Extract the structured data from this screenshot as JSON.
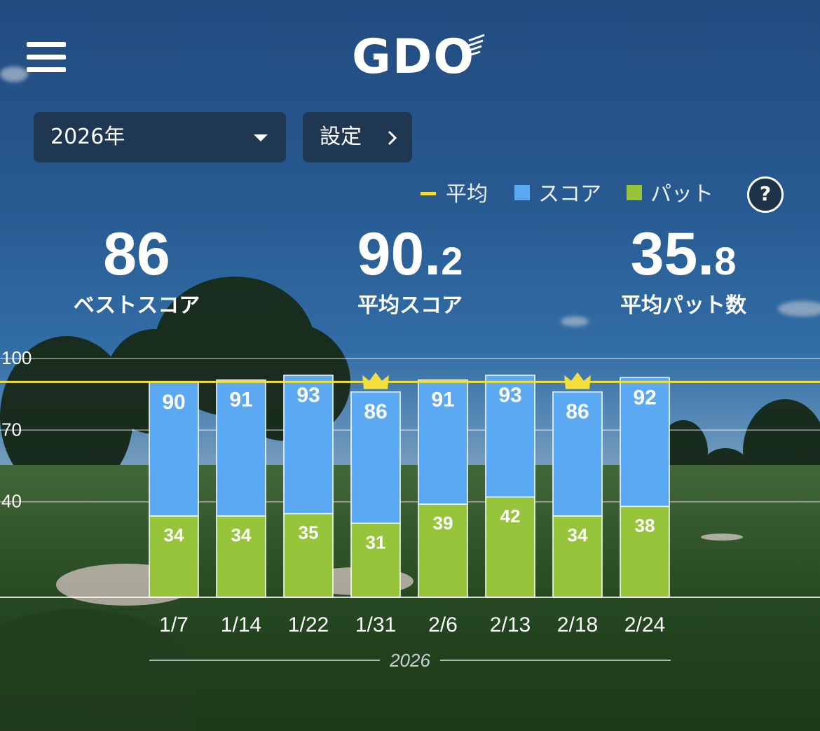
{
  "header": {
    "menu_icon": "hamburger-menu-icon",
    "logo_text": "GDO",
    "year_select": {
      "value": "2026年"
    },
    "settings_label": "設定"
  },
  "legend": [
    {
      "label": "平均",
      "color": "#f2df3b",
      "kind": "line"
    },
    {
      "label": "スコア",
      "color": "#5aa9f2",
      "kind": "box"
    },
    {
      "label": "パット",
      "color": "#96c43b",
      "kind": "box"
    }
  ],
  "help_label": "?",
  "stats": {
    "best": {
      "value": "86",
      "decimal": "",
      "label": "ベストスコア"
    },
    "avg_score": {
      "value": "90.",
      "decimal": "2",
      "label": "平均スコア"
    },
    "avg_putts": {
      "value": "35.",
      "decimal": "8",
      "label": "平均パット数"
    }
  },
  "chart_data": {
    "type": "bar",
    "categories": [
      "1/7",
      "1/14",
      "1/22",
      "1/31",
      "2/6",
      "2/13",
      "2/18",
      "2/24"
    ],
    "series": [
      {
        "name": "スコア",
        "values": [
          90,
          91,
          93,
          86,
          91,
          93,
          86,
          92
        ],
        "color": "#5aa9f2"
      },
      {
        "name": "パット",
        "values": [
          34,
          34,
          35,
          31,
          39,
          42,
          34,
          38
        ],
        "color": "#96c43b"
      }
    ],
    "average": 90.2,
    "best_marked": [
      3,
      6
    ],
    "ylim": [
      0,
      100
    ],
    "yticks": [
      100,
      70,
      40
    ],
    "year_label": "2026"
  }
}
